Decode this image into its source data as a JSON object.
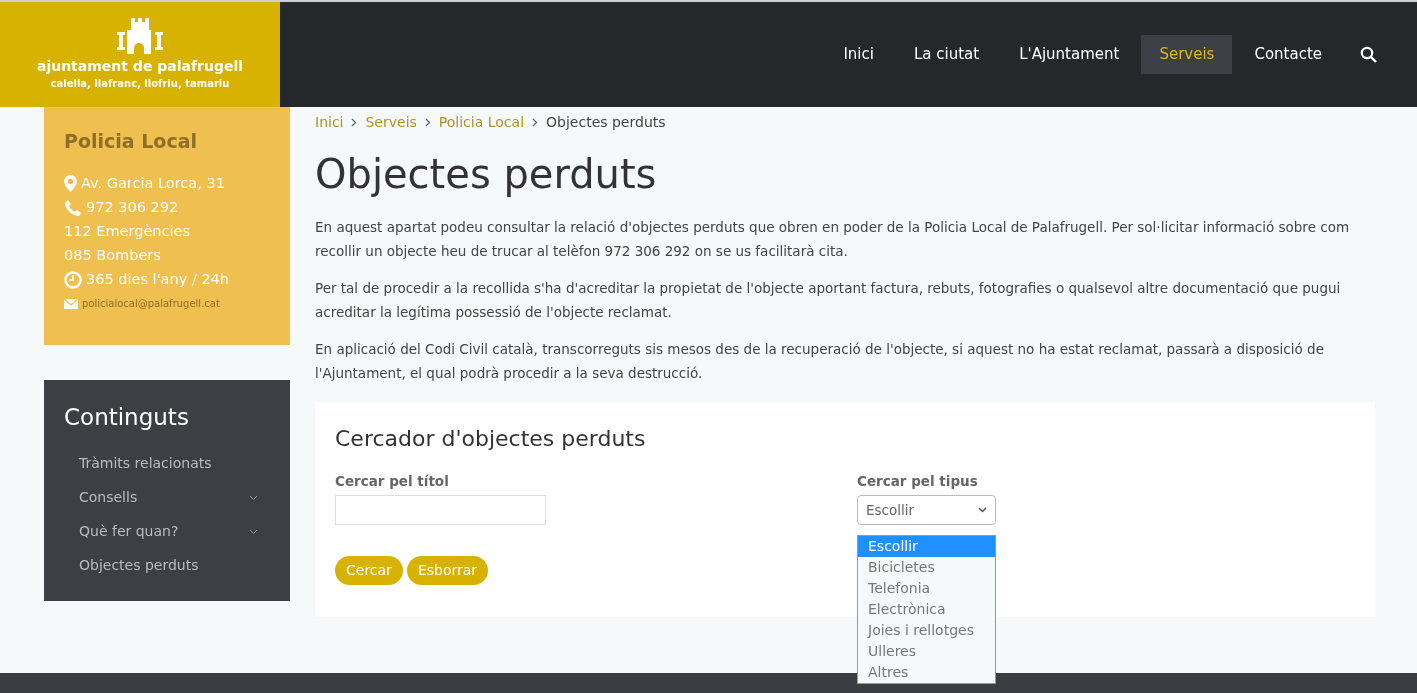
{
  "logo": {
    "title": "ajuntament de palafrugell",
    "subtitle": "calella, llafranc, llofriu, tamariu"
  },
  "nav": [
    {
      "label": "Inici",
      "selected": false
    },
    {
      "label": "La ciutat",
      "selected": false
    },
    {
      "label": "L'Ajuntament",
      "selected": false
    },
    {
      "label": "Serveis",
      "selected": true
    },
    {
      "label": "Contacte",
      "selected": false
    }
  ],
  "contact_card": {
    "title": "Policia Local",
    "lines": [
      {
        "kind": "address",
        "text": "Av. Garcia Lorca, 31"
      },
      {
        "kind": "phone",
        "text": "972 306 292"
      },
      {
        "kind": "plain",
        "text": "112 Emergències"
      },
      {
        "kind": "plain",
        "text": "085 Bombers"
      },
      {
        "kind": "hours",
        "text": "365 dies l'any / 24h"
      },
      {
        "kind": "email",
        "text": "policialocal@palafrugell.cat"
      }
    ]
  },
  "contents_menu": {
    "title": "Continguts",
    "items": [
      {
        "label": "Tràmits relacionats"
      },
      {
        "label": "Consells",
        "expanded": false
      },
      {
        "label": "Què fer quan?",
        "expanded": false
      },
      {
        "label": "Objectes perduts"
      }
    ]
  },
  "breadcrumb": [
    "Inici",
    "Serveis",
    "Policia Local",
    "Objectes perduts"
  ],
  "page_title": "Objectes perduts",
  "paragraphs": [
    "En aquest apartat podeu consultar la relació d'objectes perduts que obren en poder de la Policia Local de Palafrugell. Per sol·licitar informació sobre com recollir un objecte heu de trucar al telèfon 972 306 292 on se us facilitarà cita.",
    "Per tal de procedir a la recollida s'ha d'acreditar la propietat de l'objecte aportant factura, rebuts, fotografies o qualsevol altre documentació que pugui acreditar la legítima possessió de l'objecte reclamat.",
    "En aplicació del Codi Civil català, transcorreguts sis mesos des de la recuperació de l'objecte, si aquest no ha estat reclamat, passarà a disposició de l'Ajuntament, el qual podrà procedir a la seva destrucció."
  ],
  "search_form": {
    "title": "Cercador d'objectes perduts",
    "title_field": {
      "label": "Cercar pel títol"
    },
    "type_field": {
      "label": "Cercar pel tipus",
      "value": "Escollir",
      "options": [
        {
          "label": "Escollir",
          "selected": true
        },
        {
          "label": "Bicicletes",
          "selected": false
        },
        {
          "label": "Telefonia",
          "selected": false
        },
        {
          "label": "Electrònica",
          "selected": false
        },
        {
          "label": "Joies i rellotges",
          "selected": false
        },
        {
          "label": "Ulleres",
          "selected": false
        },
        {
          "label": "Altres",
          "selected": false
        }
      ]
    },
    "buttons": [
      "Cercar",
      "Esborrar"
    ]
  }
}
